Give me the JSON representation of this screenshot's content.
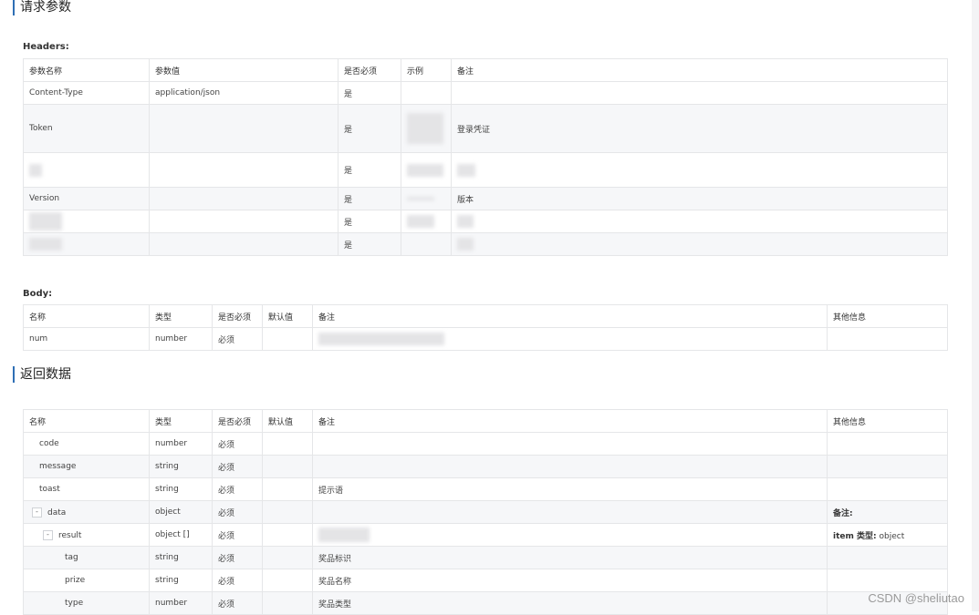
{
  "sections": {
    "request_title": "请求参数",
    "response_title": "返回数据"
  },
  "headers": {
    "label": "Headers:",
    "columns": [
      "参数名称",
      "参数值",
      "是否必须",
      "示例",
      "备注"
    ],
    "rows": [
      {
        "name": "Content-Type",
        "value": "application/json",
        "required": "是",
        "example": "",
        "note": ""
      },
      {
        "name": "Token",
        "value": "",
        "required": "是",
        "example": "",
        "note": "登录凭证"
      },
      {
        "name": "",
        "value": "",
        "required": "是",
        "example": "",
        "note": ""
      },
      {
        "name": "Version",
        "value": "",
        "required": "是",
        "example": "",
        "note": "版本"
      },
      {
        "name": "",
        "value": "",
        "required": "是",
        "example": "",
        "note": ""
      },
      {
        "name": "",
        "value": "",
        "required": "是",
        "example": "",
        "note": ""
      }
    ]
  },
  "body": {
    "label": "Body:",
    "columns": [
      "名称",
      "类型",
      "是否必须",
      "默认值",
      "备注",
      "其他信息"
    ],
    "rows": [
      {
        "name": "num",
        "type": "number",
        "required": "必须",
        "default": "",
        "note": "",
        "other": ""
      }
    ]
  },
  "response": {
    "columns": [
      "名称",
      "类型",
      "是否必须",
      "默认值",
      "备注",
      "其他信息"
    ],
    "rows": [
      {
        "name": "code",
        "type": "number",
        "required": "必须",
        "default": "",
        "note": "",
        "other": ""
      },
      {
        "name": "message",
        "type": "string",
        "required": "必须",
        "default": "",
        "note": "",
        "other": ""
      },
      {
        "name": "toast",
        "type": "string",
        "required": "必须",
        "default": "",
        "note": "提示语",
        "other": ""
      },
      {
        "name": "data",
        "type": "object",
        "required": "必须",
        "default": "",
        "note": "",
        "other": "备注:",
        "toggle": "-"
      },
      {
        "name": "result",
        "type": "object []",
        "required": "必须",
        "default": "",
        "note": "",
        "other_bold": "item 类型:",
        "other": "object",
        "toggle": "-"
      },
      {
        "name": "tag",
        "type": "string",
        "required": "必须",
        "default": "",
        "note": "奖品标识",
        "other": ""
      },
      {
        "name": "prize",
        "type": "string",
        "required": "必须",
        "default": "",
        "note": "奖品名称",
        "other": ""
      },
      {
        "name": "type",
        "type": "number",
        "required": "必须",
        "default": "",
        "note": "奖品类型",
        "other": ""
      }
    ]
  },
  "watermark": "CSDN @sheliutao"
}
